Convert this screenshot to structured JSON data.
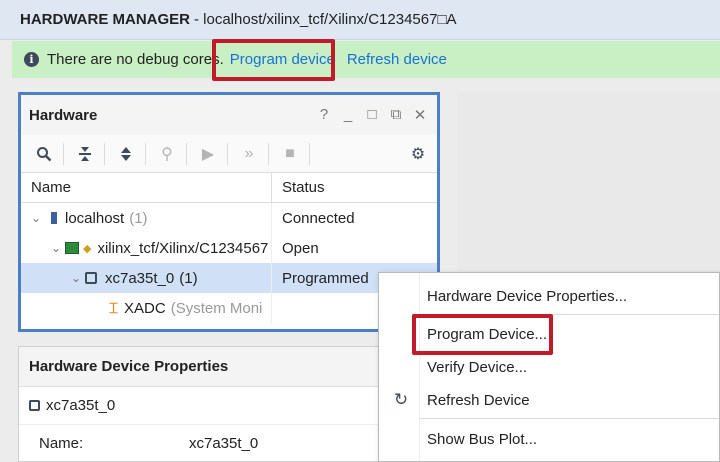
{
  "title_bar": {
    "title": "HARDWARE MANAGER",
    "path": "- localhost/xilinx_tcf/Xilinx/C1234567□A"
  },
  "banner": {
    "message": "There are no debug cores.",
    "program_link": "Program device",
    "refresh_link": "Refresh device"
  },
  "hardware_panel": {
    "title": "Hardware",
    "controls": [
      "?",
      "_",
      "□",
      "⧉",
      "✕"
    ],
    "columns": {
      "name": "Name",
      "status": "Status"
    },
    "rows": [
      {
        "name": "localhost",
        "count": "(1)",
        "status": "Connected"
      },
      {
        "name": "xilinx_tcf/Xilinx/C1234567",
        "status": "Open"
      },
      {
        "name": "xc7a35t_0",
        "count": "(1)",
        "status": "Programmed"
      },
      {
        "name": "XADC",
        "detail": "(System Moni",
        "status": ""
      }
    ]
  },
  "properties_panel": {
    "title": "Hardware Device Properties",
    "controls": [
      "?",
      "_"
    ],
    "device": "xc7a35t_0",
    "name_label": "Name:",
    "name_value": "xc7a35t_0"
  },
  "context_menu": {
    "items": [
      {
        "label": "Hardware Device Properties..."
      },
      {
        "label": "Program Device..."
      },
      {
        "label": "Verify Device..."
      },
      {
        "label": "Refresh Device"
      },
      {
        "label": "Show Bus Plot..."
      }
    ]
  },
  "colors": {
    "highlight_box": "#c11a2b",
    "link": "#1a6fd6",
    "banner_bg": "#c9f0c4",
    "selected_row": "#cfe0f7",
    "panel_border": "#4d7fc4"
  }
}
